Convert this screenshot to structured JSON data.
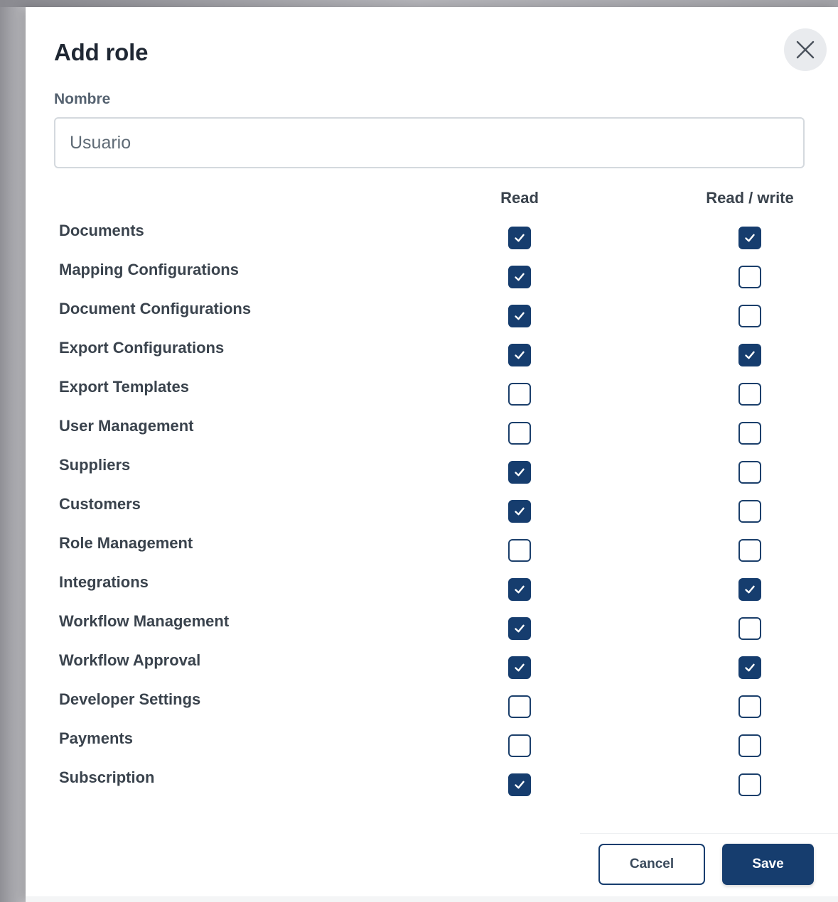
{
  "dialog": {
    "title": "Add role",
    "close_icon": "close-icon"
  },
  "name_field": {
    "label": "Nombre",
    "value": "Usuario"
  },
  "columns": {
    "read": "Read",
    "read_write": "Read / write"
  },
  "permissions": [
    {
      "label": "Documents",
      "read": true,
      "read_write": true
    },
    {
      "label": "Mapping Configurations",
      "read": true,
      "read_write": false
    },
    {
      "label": "Document Configurations",
      "read": true,
      "read_write": false
    },
    {
      "label": "Export Configurations",
      "read": true,
      "read_write": true
    },
    {
      "label": "Export Templates",
      "read": false,
      "read_write": false
    },
    {
      "label": "User Management",
      "read": false,
      "read_write": false
    },
    {
      "label": "Suppliers",
      "read": true,
      "read_write": false
    },
    {
      "label": "Customers",
      "read": true,
      "read_write": false
    },
    {
      "label": "Role Management",
      "read": false,
      "read_write": false
    },
    {
      "label": "Integrations",
      "read": true,
      "read_write": true
    },
    {
      "label": "Workflow Management",
      "read": true,
      "read_write": false
    },
    {
      "label": "Workflow Approval",
      "read": true,
      "read_write": true
    },
    {
      "label": "Developer Settings",
      "read": false,
      "read_write": false
    },
    {
      "label": "Payments",
      "read": false,
      "read_write": false
    },
    {
      "label": "Subscription",
      "read": true,
      "read_write": false
    }
  ],
  "footer": {
    "cancel_label": "Cancel",
    "save_label": "Save"
  },
  "colors": {
    "accent": "#163d6e",
    "title_text": "#1f2733",
    "label_text": "#3a434d",
    "field_label_text": "#556270"
  }
}
